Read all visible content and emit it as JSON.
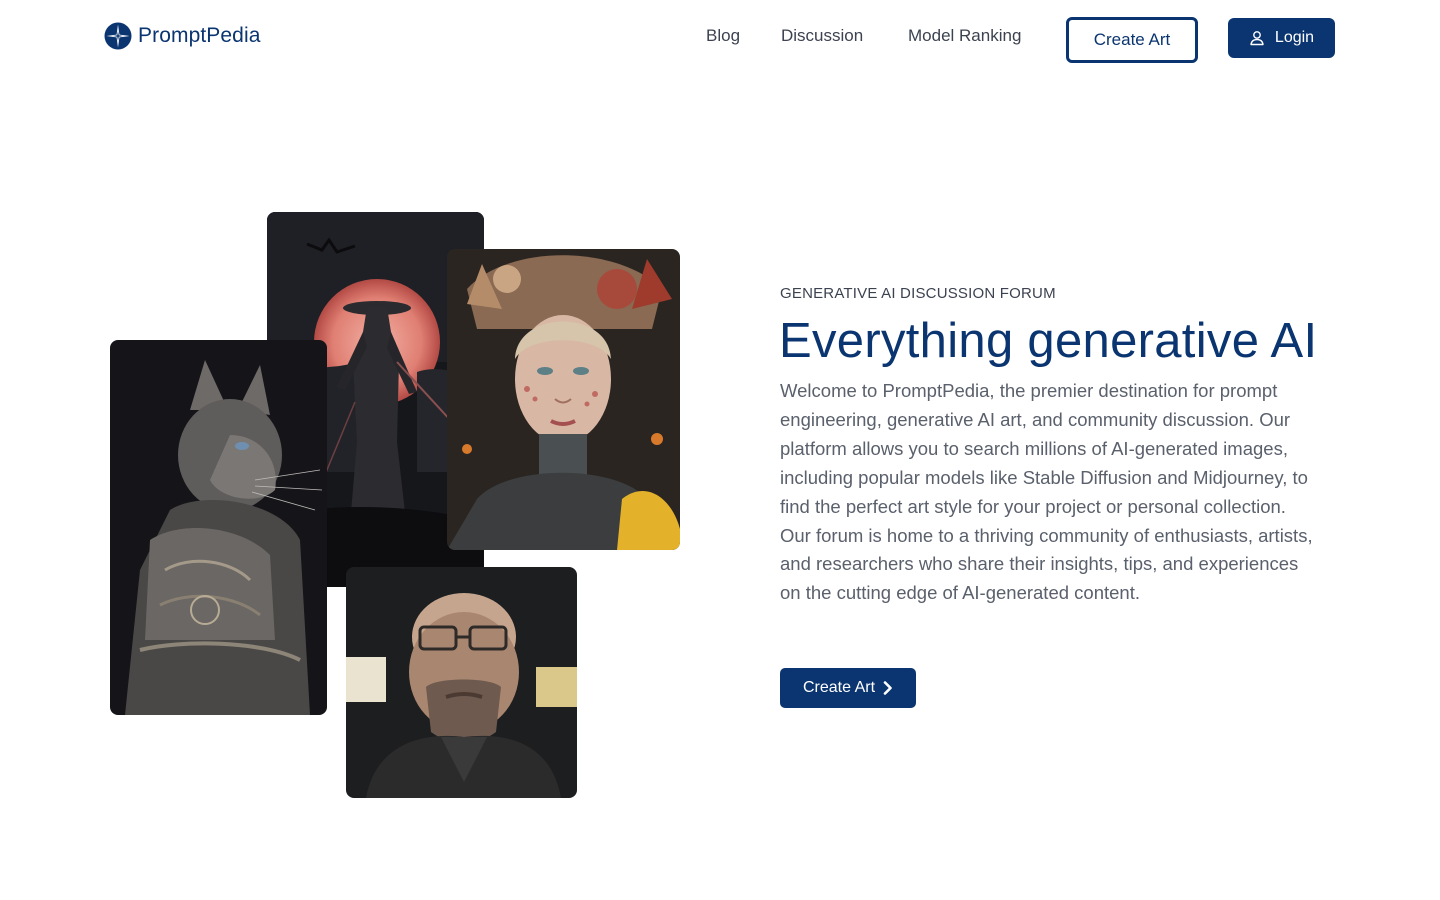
{
  "brand": {
    "name": "PromptPedia",
    "logo_icon": "compass-star-icon",
    "color": "#0b3570"
  },
  "nav": {
    "blog": "Blog",
    "discussion": "Discussion",
    "model_ranking": "Model Ranking",
    "create_art": "Create Art",
    "login": "Login",
    "login_icon": "user-icon"
  },
  "hero": {
    "eyebrow": "GENERATIVE AI DISCUSSION FORUM",
    "headline": "Everything generative AI",
    "body": "Welcome to PromptPedia, the premier destination for prompt engineering, generative AI art, and community discussion. Our platform allows you to search millions of AI-generated images, including popular models like Stable Diffusion and Midjourney, to find the perfect art style for your project or personal collection. Our forum is home to a thriving community of enthusiasts, artists, and researchers who share their insights, tips, and experiences on the cutting edge of AI-generated content.",
    "cta": "Create Art",
    "cta_icon": "chevron-right-icon"
  },
  "gallery": [
    "samurai-moon-image",
    "ornate-woman-portrait-image",
    "armored-cat-image",
    "bearded-man-portrait-image"
  ]
}
